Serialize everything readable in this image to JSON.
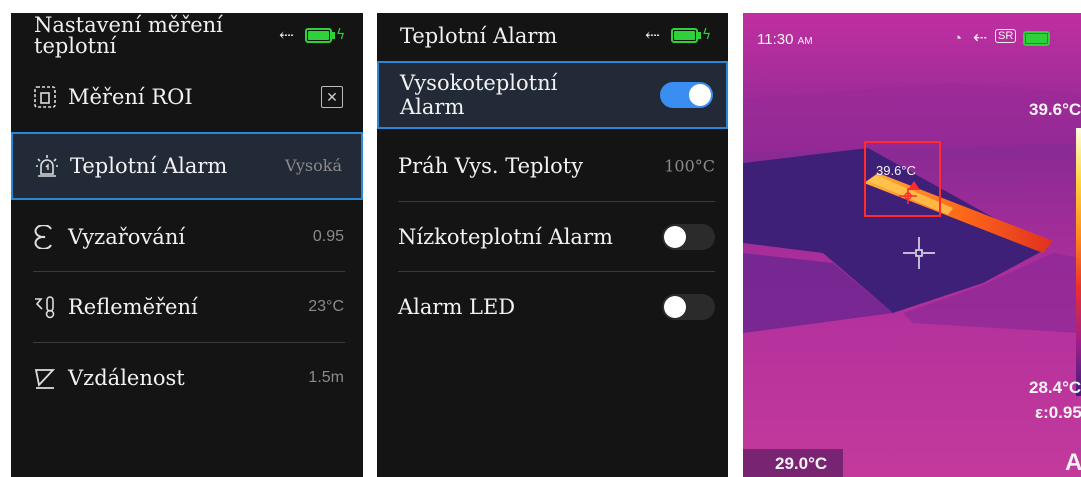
{
  "screen1": {
    "title": "Nastavení měření teplotní",
    "items": [
      {
        "label": "Měření ROI",
        "value": "✕",
        "icon": "roi-icon"
      },
      {
        "label": "Teplotní Alarm",
        "value": "Vysoká",
        "icon": "alarm-light-icon"
      },
      {
        "label": "Vyzařování",
        "value": "0.95",
        "icon": "emissivity-icon"
      },
      {
        "label": "Reflemĕření",
        "value": "23°C",
        "icon": "reflected-temp-icon"
      },
      {
        "label": "Vzdálenost",
        "value": "1.5m",
        "icon": "distance-icon"
      }
    ]
  },
  "screen2": {
    "title": "Teplotní Alarm",
    "items": [
      {
        "label": "Vysokoteplotní Alarm",
        "toggle": true
      },
      {
        "label": "Práh Vys. Teploty",
        "value": "100°C"
      },
      {
        "label": "Nízkoteplotní Alarm",
        "toggle": false
      },
      {
        "label": "Alarm LED",
        "toggle": false
      }
    ]
  },
  "screen3": {
    "time": "11:30",
    "ampm": "AM",
    "sr_badge": "SR",
    "max_temp": "39.6°C",
    "roi_temp": "39.6°C",
    "min_temp": "28.4°C",
    "emissivity": "ε:0.95",
    "center_temp": "29.0°C",
    "mode": "A"
  },
  "colors": {
    "accent": "#3a8ef1",
    "selection_border": "#2a86d6",
    "battery": "#2fd03a",
    "roi_box": "#ff2c2c"
  }
}
